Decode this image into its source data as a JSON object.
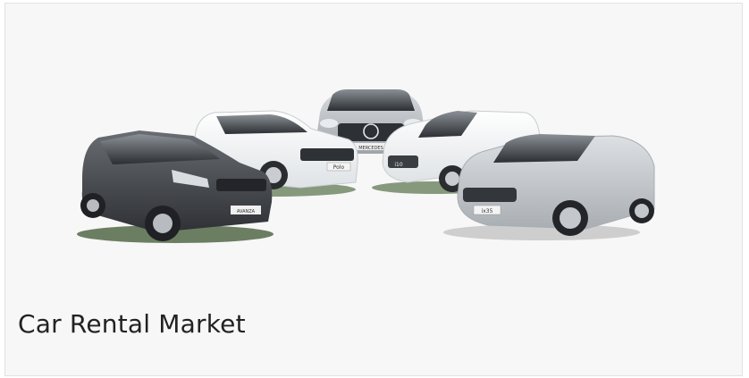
{
  "card": {
    "title": "Car Rental Market",
    "image": {
      "plates": [
        "AVANZA",
        "Polo",
        "MERCEDES",
        "i10",
        "ix35"
      ]
    }
  },
  "colors": {
    "background": "#f7f7f7",
    "caption_text": "#222222",
    "car_dark_grey": "#4a4d52",
    "car_white": "#f2f4f5",
    "car_silver": "#b9bdc1",
    "car_light_silver": "#c9ccd0"
  }
}
